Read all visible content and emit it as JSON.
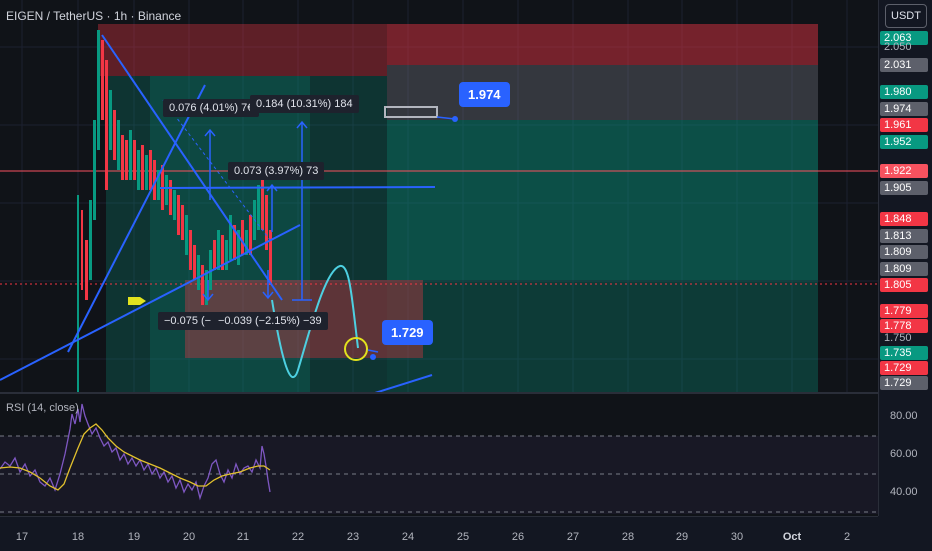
{
  "header": {
    "symbol_line": "EIGEN / TetherUS · 1h · Binance",
    "currency": "USDT"
  },
  "colors": {
    "green": "#089981",
    "red": "#f23645",
    "grey": "#5d606b",
    "blue": "#2962ff",
    "rsi_line": "#7e57c2",
    "rsi_ma": "#e2c12d",
    "current_line": "#f7525f"
  },
  "price_labels": [
    {
      "text": "2.063",
      "kind": "green"
    },
    {
      "text": "2.050",
      "kind": "plain"
    },
    {
      "text": "2.031",
      "kind": "grey"
    },
    {
      "text": "1.980",
      "kind": "green"
    },
    {
      "text": "1.974",
      "kind": "grey"
    },
    {
      "text": "1.961",
      "kind": "red"
    },
    {
      "text": "1.952",
      "kind": "green"
    },
    {
      "text": "1.922",
      "kind": "current"
    },
    {
      "text": "1.905",
      "kind": "grey"
    },
    {
      "text": "1.848",
      "kind": "red"
    },
    {
      "text": "1.813",
      "kind": "grey"
    },
    {
      "text": "1.809",
      "kind": "grey"
    },
    {
      "text": "1.809",
      "kind": "grey"
    },
    {
      "text": "1.805",
      "kind": "red"
    },
    {
      "text": "1.779",
      "kind": "red"
    },
    {
      "text": "1.778",
      "kind": "red"
    },
    {
      "text": "1.750",
      "kind": "plain"
    },
    {
      "text": "1.735",
      "kind": "green"
    },
    {
      "text": "1.729",
      "kind": "red"
    },
    {
      "text": "1.729",
      "kind": "grey"
    }
  ],
  "rsi": {
    "title": "RSI (14, close)",
    "levels": [
      "80.00",
      "60.00",
      "40.00"
    ]
  },
  "time_axis": [
    "17",
    "18",
    "19",
    "20",
    "21",
    "22",
    "23",
    "24",
    "25",
    "26",
    "27",
    "28",
    "29",
    "30",
    "Oct",
    "2"
  ],
  "measurements": [
    {
      "text": "0.076 (4.01%) 7€"
    },
    {
      "text": "0.184 (10.31%) 184"
    },
    {
      "text": "0.073 (3.97%) 73"
    },
    {
      "text": "−0.075 (−"
    },
    {
      "text": "−0.039 (−2.15%) −39"
    }
  ],
  "callouts": {
    "target": "1.974",
    "low": "1.729"
  }
}
